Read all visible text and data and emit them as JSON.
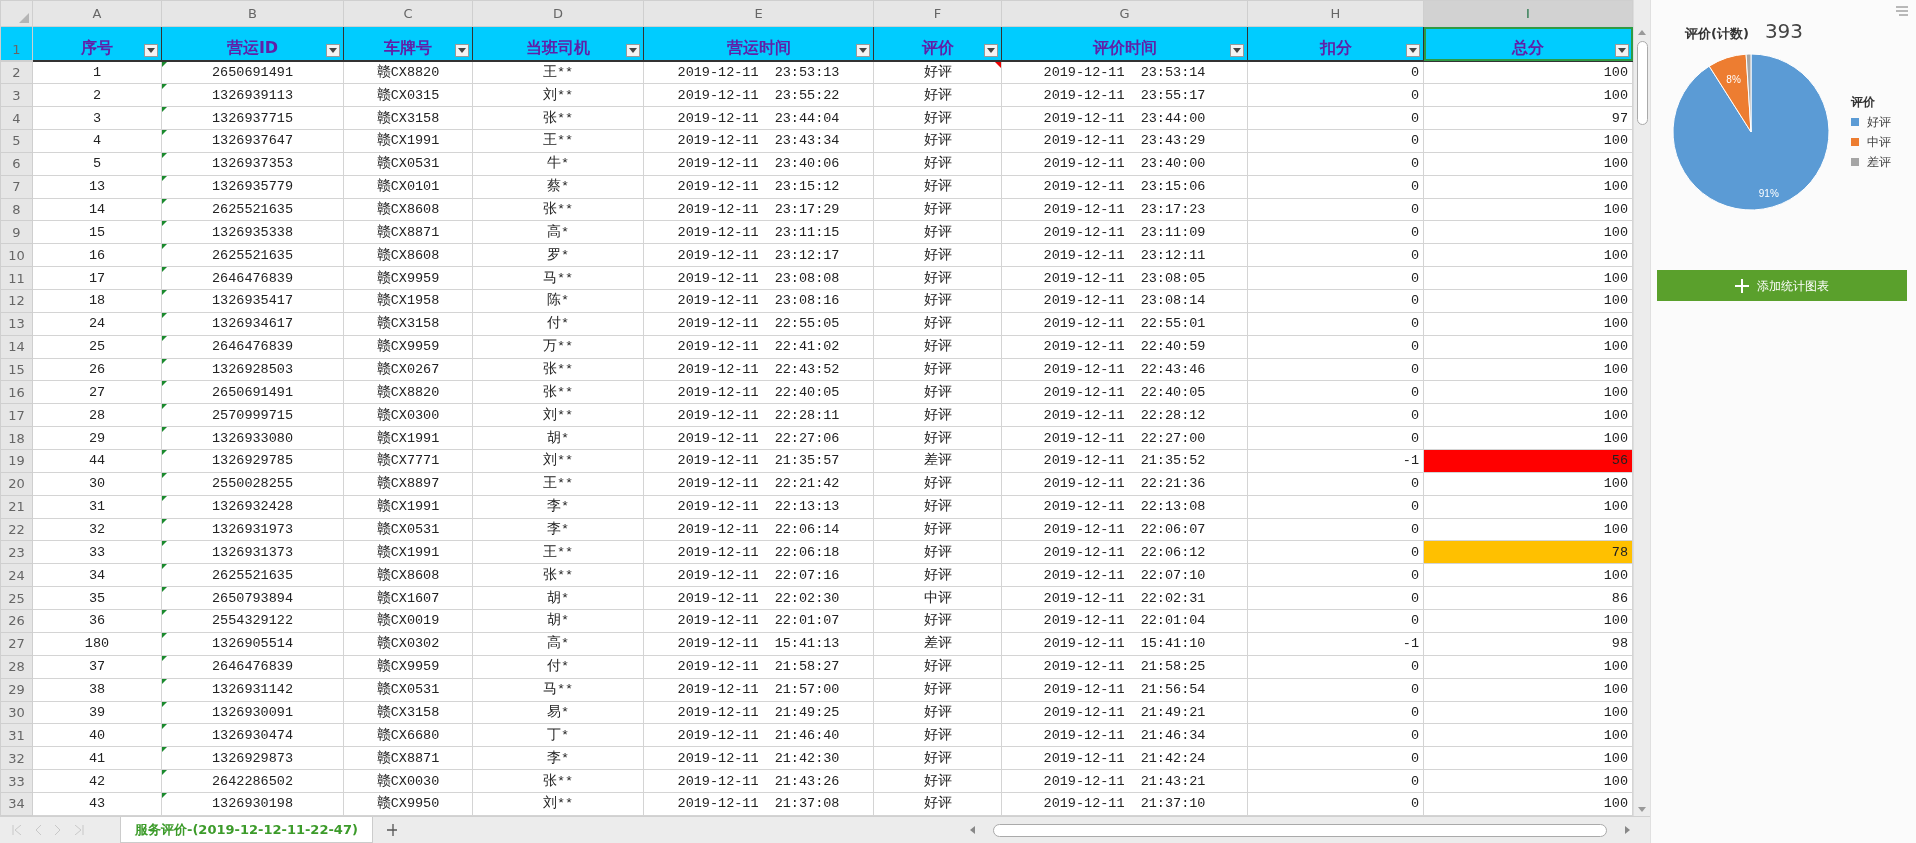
{
  "sheet": {
    "columns": [
      {
        "letter": "A",
        "title": "序号",
        "selected": false,
        "kind": "centered"
      },
      {
        "letter": "B",
        "title": "营运ID",
        "selected": false,
        "kind": "flagged"
      },
      {
        "letter": "C",
        "title": "车牌号",
        "selected": false,
        "kind": "centered"
      },
      {
        "letter": "D",
        "title": "当班司机",
        "selected": false,
        "kind": "centered"
      },
      {
        "letter": "E",
        "title": "营运时间",
        "selected": false,
        "kind": "centered"
      },
      {
        "letter": "F",
        "title": "评价",
        "selected": false,
        "kind": "centered"
      },
      {
        "letter": "G",
        "title": "评价时间",
        "selected": false,
        "kind": "centered"
      },
      {
        "letter": "H",
        "title": "扣分",
        "selected": false,
        "kind": "numeric"
      },
      {
        "letter": "I",
        "title": "总分",
        "selected": true,
        "kind": "numeric"
      }
    ],
    "header_row_number": "1",
    "rows": [
      {
        "row_number": "2",
        "comment": true,
        "cells": [
          "1",
          "2650691491",
          "赣CX8820",
          "王**",
          "2019-12-11 23:53:13",
          "好评",
          "2019-12-11 23:53:14",
          "0",
          "100"
        ]
      },
      {
        "row_number": "3",
        "comment": false,
        "cells": [
          "2",
          "1326939113",
          "赣CX0315",
          "刘**",
          "2019-12-11 23:55:22",
          "好评",
          "2019-12-11 23:55:17",
          "0",
          "100"
        ]
      },
      {
        "row_number": "4",
        "comment": false,
        "cells": [
          "3",
          "1326937715",
          "赣CX3158",
          "张**",
          "2019-12-11 23:44:04",
          "好评",
          "2019-12-11 23:44:00",
          "0",
          "97"
        ]
      },
      {
        "row_number": "5",
        "comment": false,
        "cells": [
          "4",
          "1326937647",
          "赣CX1991",
          "王**",
          "2019-12-11 23:43:34",
          "好评",
          "2019-12-11 23:43:29",
          "0",
          "100"
        ]
      },
      {
        "row_number": "6",
        "comment": false,
        "cells": [
          "5",
          "1326937353",
          "赣CX0531",
          "牛*",
          "2019-12-11 23:40:06",
          "好评",
          "2019-12-11 23:40:00",
          "0",
          "100"
        ]
      },
      {
        "row_number": "7",
        "comment": false,
        "cells": [
          "13",
          "1326935779",
          "赣CX0101",
          "蔡*",
          "2019-12-11 23:15:12",
          "好评",
          "2019-12-11 23:15:06",
          "0",
          "100"
        ]
      },
      {
        "row_number": "8",
        "comment": false,
        "cells": [
          "14",
          "2625521635",
          "赣CX8608",
          "张**",
          "2019-12-11 23:17:29",
          "好评",
          "2019-12-11 23:17:23",
          "0",
          "100"
        ]
      },
      {
        "row_number": "9",
        "comment": false,
        "cells": [
          "15",
          "1326935338",
          "赣CX8871",
          "高*",
          "2019-12-11 23:11:15",
          "好评",
          "2019-12-11 23:11:09",
          "0",
          "100"
        ]
      },
      {
        "row_number": "10",
        "comment": false,
        "cells": [
          "16",
          "2625521635",
          "赣CX8608",
          "罗*",
          "2019-12-11 23:12:17",
          "好评",
          "2019-12-11 23:12:11",
          "0",
          "100"
        ]
      },
      {
        "row_number": "11",
        "comment": false,
        "cells": [
          "17",
          "2646476839",
          "赣CX9959",
          "马**",
          "2019-12-11 23:08:08",
          "好评",
          "2019-12-11 23:08:05",
          "0",
          "100"
        ]
      },
      {
        "row_number": "12",
        "comment": false,
        "cells": [
          "18",
          "1326935417",
          "赣CX1958",
          "陈*",
          "2019-12-11 23:08:16",
          "好评",
          "2019-12-11 23:08:14",
          "0",
          "100"
        ]
      },
      {
        "row_number": "13",
        "comment": false,
        "cells": [
          "24",
          "1326934617",
          "赣CX3158",
          "付*",
          "2019-12-11 22:55:05",
          "好评",
          "2019-12-11 22:55:01",
          "0",
          "100"
        ]
      },
      {
        "row_number": "14",
        "comment": false,
        "cells": [
          "25",
          "2646476839",
          "赣CX9959",
          "万**",
          "2019-12-11 22:41:02",
          "好评",
          "2019-12-11 22:40:59",
          "0",
          "100"
        ]
      },
      {
        "row_number": "15",
        "comment": false,
        "cells": [
          "26",
          "1326928503",
          "赣CX0267",
          "张**",
          "2019-12-11 22:43:52",
          "好评",
          "2019-12-11 22:43:46",
          "0",
          "100"
        ]
      },
      {
        "row_number": "16",
        "comment": false,
        "cells": [
          "27",
          "2650691491",
          "赣CX8820",
          "张**",
          "2019-12-11 22:40:05",
          "好评",
          "2019-12-11 22:40:05",
          "0",
          "100"
        ]
      },
      {
        "row_number": "17",
        "comment": false,
        "cells": [
          "28",
          "2570999715",
          "赣CX0300",
          "刘**",
          "2019-12-11 22:28:11",
          "好评",
          "2019-12-11 22:28:12",
          "0",
          "100"
        ]
      },
      {
        "row_number": "18",
        "comment": false,
        "cells": [
          "29",
          "1326933080",
          "赣CX1991",
          "胡*",
          "2019-12-11 22:27:06",
          "好评",
          "2019-12-11 22:27:00",
          "0",
          "100"
        ]
      },
      {
        "row_number": "19",
        "comment": false,
        "color": "#ff0000",
        "cells": [
          "44",
          "1326929785",
          "赣CX7771",
          "刘**",
          "2019-12-11 21:35:57",
          "差评",
          "2019-12-11 21:35:52",
          "-1",
          "56"
        ]
      },
      {
        "row_number": "20",
        "comment": false,
        "cells": [
          "30",
          "2550028255",
          "赣CX8897",
          "王**",
          "2019-12-11 22:21:42",
          "好评",
          "2019-12-11 22:21:36",
          "0",
          "100"
        ]
      },
      {
        "row_number": "21",
        "comment": false,
        "cells": [
          "31",
          "1326932428",
          "赣CX1991",
          "李*",
          "2019-12-11 22:13:13",
          "好评",
          "2019-12-11 22:13:08",
          "0",
          "100"
        ]
      },
      {
        "row_number": "22",
        "comment": false,
        "cells": [
          "32",
          "1326931973",
          "赣CX0531",
          "李*",
          "2019-12-11 22:06:14",
          "好评",
          "2019-12-11 22:06:07",
          "0",
          "100"
        ]
      },
      {
        "row_number": "23",
        "comment": false,
        "color": "#ffc000",
        "cells": [
          "33",
          "1326931373",
          "赣CX1991",
          "王**",
          "2019-12-11 22:06:18",
          "好评",
          "2019-12-11 22:06:12",
          "0",
          "78"
        ]
      },
      {
        "row_number": "24",
        "comment": false,
        "cells": [
          "34",
          "2625521635",
          "赣CX8608",
          "张**",
          "2019-12-11 22:07:16",
          "好评",
          "2019-12-11 22:07:10",
          "0",
          "100"
        ]
      },
      {
        "row_number": "25",
        "comment": false,
        "cells": [
          "35",
          "2650793894",
          "赣CX1607",
          "胡*",
          "2019-12-11 22:02:30",
          "中评",
          "2019-12-11 22:02:31",
          "0",
          "86"
        ]
      },
      {
        "row_number": "26",
        "comment": false,
        "cells": [
          "36",
          "2554329122",
          "赣CX0019",
          "胡*",
          "2019-12-11 22:01:07",
          "好评",
          "2019-12-11 22:01:04",
          "0",
          "100"
        ]
      },
      {
        "row_number": "27",
        "comment": false,
        "cells": [
          "180",
          "1326905514",
          "赣CX0302",
          "高*",
          "2019-12-11 15:41:13",
          "差评",
          "2019-12-11 15:41:10",
          "-1",
          "98"
        ]
      },
      {
        "row_number": "28",
        "comment": false,
        "cells": [
          "37",
          "2646476839",
          "赣CX9959",
          "付*",
          "2019-12-11 21:58:27",
          "好评",
          "2019-12-11 21:58:25",
          "0",
          "100"
        ]
      },
      {
        "row_number": "29",
        "comment": false,
        "cells": [
          "38",
          "1326931142",
          "赣CX0531",
          "马**",
          "2019-12-11 21:57:00",
          "好评",
          "2019-12-11 21:56:54",
          "0",
          "100"
        ]
      },
      {
        "row_number": "30",
        "comment": false,
        "cells": [
          "39",
          "1326930091",
          "赣CX3158",
          "易*",
          "2019-12-11 21:49:25",
          "好评",
          "2019-12-11 21:49:21",
          "0",
          "100"
        ]
      },
      {
        "row_number": "31",
        "comment": false,
        "cells": [
          "40",
          "1326930474",
          "赣CX6680",
          "丁*",
          "2019-12-11 21:46:40",
          "好评",
          "2019-12-11 21:46:34",
          "0",
          "100"
        ]
      },
      {
        "row_number": "32",
        "comment": false,
        "cells": [
          "41",
          "1326929873",
          "赣CX8871",
          "李*",
          "2019-12-11 21:42:30",
          "好评",
          "2019-12-11 21:42:24",
          "0",
          "100"
        ]
      },
      {
        "row_number": "33",
        "comment": false,
        "cells": [
          "42",
          "2642286502",
          "赣CX0030",
          "张**",
          "2019-12-11 21:43:26",
          "好评",
          "2019-12-11 21:43:21",
          "0",
          "100"
        ]
      },
      {
        "row_number": "34",
        "comment": false,
        "cells": [
          "43",
          "1326930198",
          "赣CX9950",
          "刘**",
          "2019-12-11 21:37:08",
          "好评",
          "2019-12-11 21:37:10",
          "0",
          "100"
        ]
      }
    ]
  },
  "sheet_tabs": [
    {
      "label": "服务评价-(2019-12-12-11-22-47)",
      "selected": true
    }
  ],
  "stats_panel": {
    "title": "评价(计数)",
    "count": "393",
    "chart_data": {
      "type": "pie",
      "categories": [
        "好评",
        "中评",
        "差评"
      ],
      "series": [
        {
          "name": "评价",
          "values": [
            91,
            8,
            1
          ]
        }
      ],
      "colors": [
        "#5b9bd5",
        "#ed7d31",
        "#a5a5a5"
      ],
      "value_labels": [
        "91%",
        "8%",
        null
      ]
    },
    "add_button": "添加统计图表"
  }
}
